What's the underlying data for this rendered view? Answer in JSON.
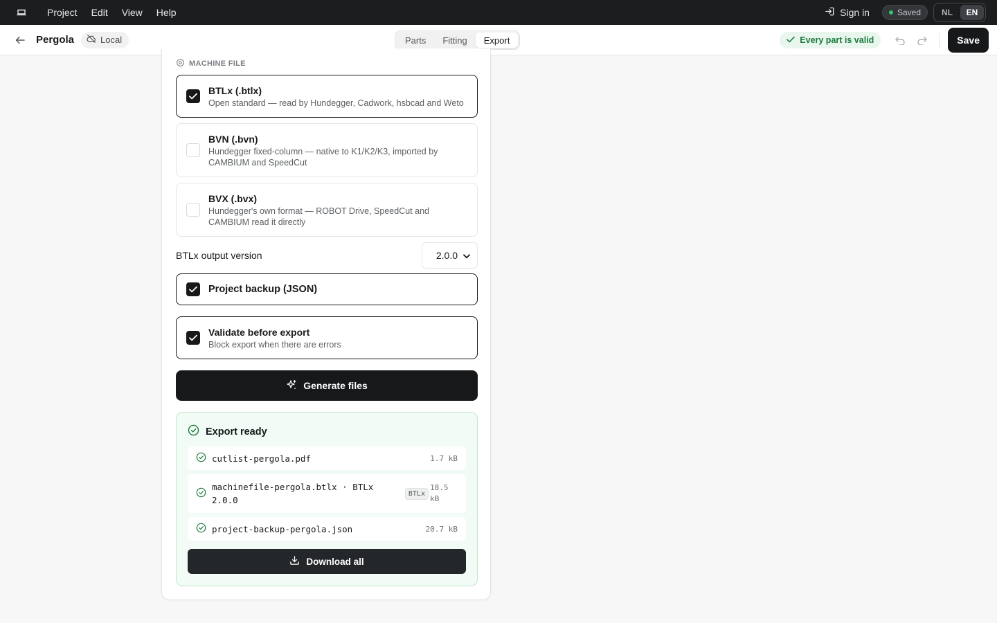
{
  "menubar": {
    "logo_icon": "laptop-icon",
    "menu": [
      "Project",
      "Edit",
      "View",
      "Help"
    ],
    "sign_in": "Sign in",
    "status": "Saved",
    "languages": [
      "NL",
      "EN"
    ],
    "active_language": "EN"
  },
  "toolbar": {
    "project_name": "Pergola",
    "storage": "Local",
    "tabs": [
      "Parts",
      "Fitting",
      "Export"
    ],
    "active_tab": "Export",
    "validation": "Every part is valid",
    "save": "Save"
  },
  "export": {
    "section_label": "MACHINE FILE",
    "formats": [
      {
        "title": "BTLx (.btlx)",
        "desc": "Open standard — read by Hundegger, Cadwork, hsbcad and Weto",
        "checked": true
      },
      {
        "title": "BVN (.bvn)",
        "desc": "Hundegger fixed-column — native to K1/K2/K3, imported by CAMBIUM and SpeedCut",
        "checked": false
      },
      {
        "title": "BVX (.bvx)",
        "desc": "Hundegger's own format — ROBOT Drive, SpeedCut and CAMBIUM read it directly",
        "checked": false
      }
    ],
    "version_label": "BTLx output version",
    "version_value": "2.0.0",
    "backup": {
      "title": "Project backup (JSON)",
      "checked": true
    },
    "validate": {
      "title": "Validate before export",
      "desc": "Block export when there are errors",
      "checked": true
    },
    "generate": "Generate files",
    "ready": {
      "title": "Export ready",
      "files": [
        {
          "name": "cutlist-pergola.pdf",
          "badge": "",
          "size": "1.7 kB"
        },
        {
          "name": "machinefile-pergola.btlx · BTLx 2.0.0",
          "badge": "BTLx",
          "size": "18.5 kB"
        },
        {
          "name": "project-backup-pergola.json",
          "badge": "",
          "size": "20.7 kB"
        }
      ],
      "download": "Download all"
    }
  },
  "colors": {
    "dark": "#16181a",
    "menubar_bg": "#1b1d1f",
    "success": "#1d7a3e",
    "success_bg": "#f2fbf5",
    "page_bg": "#f6f7f6"
  }
}
